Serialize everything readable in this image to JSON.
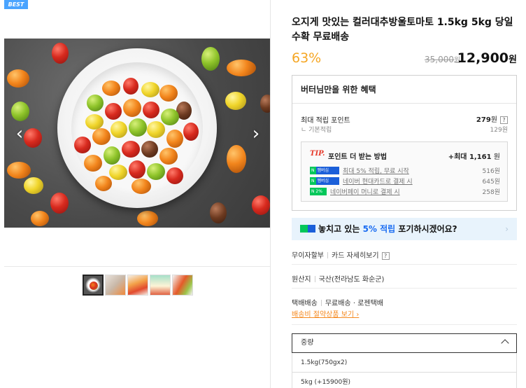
{
  "gallery": {
    "badge": "BEST",
    "prev": "‹",
    "next": "›",
    "thumbnails": [
      "thumb-1",
      "thumb-2",
      "thumb-3",
      "thumb-4",
      "thumb-5"
    ]
  },
  "product": {
    "title": "오지게 맛있는 컬러대추방울토마토 1.5kg 5kg 당일수확 무료배송",
    "discount": "63%",
    "original_price": "35,000",
    "original_unit": "원",
    "sale_price": "12,900",
    "sale_unit": "원"
  },
  "benefits": {
    "heading": "버터님만을 위한 혜택",
    "max_points_label": "최대 적립 포인트",
    "max_points_value": "279",
    "max_points_unit": "원",
    "help": "?",
    "basic_label": "기본적립",
    "basic_value": "129원",
    "tip_logo": "TIP.",
    "tip_title": "포인트 더 받는 방법",
    "tip_max_prefix": "+최대 ",
    "tip_max_value": "1,161",
    "tip_max_unit": " 원",
    "tips": [
      {
        "badge_n": "N",
        "badge": "멤버십",
        "text": "최대 5% 적립, 무료 시작",
        "amount": "516원"
      },
      {
        "badge_n": "N",
        "badge": "멤버십",
        "text": "네이버 현대카드로 결제 시",
        "amount": "645원"
      },
      {
        "badge_n": "N",
        "badge": "2%",
        "text": "네이버페이 머니로 결제 시",
        "amount": "258원"
      }
    ]
  },
  "np_banner": {
    "prefix": "놓치고 있는 ",
    "highlight": "5% 적립",
    "suffix": " 포기하시겠어요?",
    "chevron": "›"
  },
  "payment": {
    "installment": "무이자할부",
    "card_detail": "카드 자세히보기",
    "help": "?"
  },
  "origin": {
    "label": "원산지",
    "value": "국산(전라남도 화순군)"
  },
  "shipping": {
    "method": "택배배송",
    "fee": "무료배송",
    "dot": "·",
    "carrier": "로젠택배",
    "saving_link": "배송비 절약상품 보기 ›"
  },
  "options": {
    "label": "중량",
    "items": [
      "1.5kg(750gx2)",
      "5kg (+15900원)"
    ]
  },
  "colors": {
    "accent_orange": "#f5a623",
    "naver_green": "#03c75a",
    "naver_blue": "#1b5fd9",
    "highlight_blue": "#1b6df2",
    "tip_red": "#e63a2b"
  }
}
